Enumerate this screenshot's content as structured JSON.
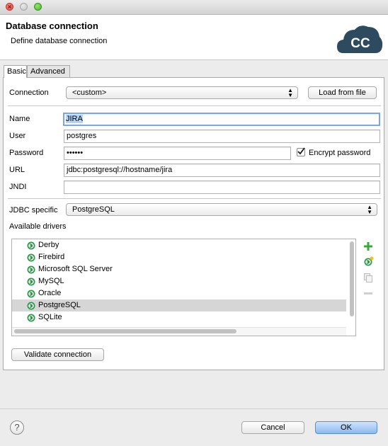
{
  "window": {
    "title": ""
  },
  "header": {
    "title": "Database connection",
    "subtitle": "Define database connection",
    "logo_text": "CC"
  },
  "tabs": [
    {
      "label": "Basic",
      "active": true
    },
    {
      "label": "Advanced",
      "active": false
    }
  ],
  "connection": {
    "label": "Connection",
    "value": "<custom>",
    "load_button": "Load from file"
  },
  "fields": {
    "name": {
      "label": "Name",
      "value": "JIRA"
    },
    "user": {
      "label": "User",
      "value": "postgres"
    },
    "password": {
      "label": "Password",
      "value": "••••••"
    },
    "encrypt": {
      "label": "Encrypt password",
      "checked": true
    },
    "url": {
      "label": "URL",
      "value": "jdbc:postgresql://hostname/jira"
    },
    "jndi": {
      "label": "JNDI",
      "value": ""
    }
  },
  "jdbc": {
    "label": "JDBC specific",
    "value": "PostgreSQL"
  },
  "drivers": {
    "label": "Available drivers",
    "items": [
      "Derby",
      "Firebird",
      "Microsoft SQL Server",
      "MySQL",
      "Oracle",
      "PostgreSQL",
      "SQLite"
    ],
    "selected": "PostgreSQL"
  },
  "validate_button": "Validate connection",
  "footer": {
    "help": "?",
    "cancel": "Cancel",
    "ok": "OK"
  },
  "icons": {
    "add": "plus-icon",
    "add_driver": "add-driver-icon",
    "copy": "copy-icon",
    "remove": "minus-icon",
    "driver": "driver-icon"
  },
  "colors": {
    "accent": "#5d8fcf",
    "logo_bg": "#2e4a5e",
    "driver_icon": "#2a9a48",
    "selection": "#d6d6d6"
  }
}
